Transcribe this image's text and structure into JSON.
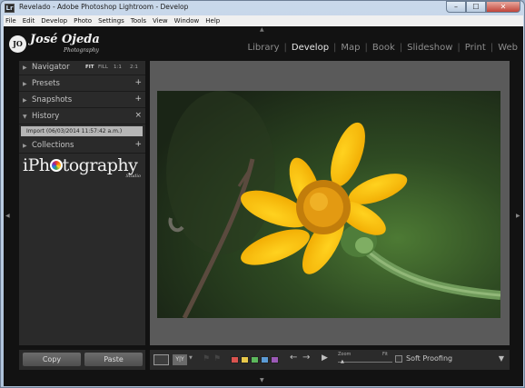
{
  "window": {
    "app_icon": "Lr",
    "title": "Revelado - Adobe Photoshop Lightroom - Develop",
    "minimize": "–",
    "maximize": "☐",
    "close": "✕"
  },
  "menubar": [
    "File",
    "Edit",
    "Develop",
    "Photo",
    "Settings",
    "Tools",
    "View",
    "Window",
    "Help"
  ],
  "identity_plate": {
    "monogram": "JO",
    "name": "José Ojeda",
    "subtitle": "Photography"
  },
  "modules": [
    "Library",
    "Develop",
    "Map",
    "Book",
    "Slideshow",
    "Print",
    "Web"
  ],
  "active_module": "Develop",
  "left_panel": {
    "navigator": {
      "label": "Navigator",
      "zoom": [
        "FIT",
        "FILL",
        "1:1",
        "2:1"
      ]
    },
    "presets": {
      "label": "Presets",
      "action": "+"
    },
    "snapshots": {
      "label": "Snapshots",
      "action": "+"
    },
    "history": {
      "label": "History",
      "action": "×",
      "entry": "Import (06/03/2014 11:57:42 a.m.)"
    },
    "collections": {
      "label": "Collections",
      "action": "+"
    },
    "studio_logo": {
      "text_before": "iPh",
      "text_after": "tography",
      "tagline": "Studio"
    }
  },
  "left_buttons": {
    "copy": "Copy",
    "paste": "Paste"
  },
  "photo": {
    "subject": "yellow flower"
  },
  "toolbar": {
    "before_after": "Y|Y",
    "zoom_label": "Zoom",
    "fit_label": "Fit",
    "soft_proofing": "Soft Proofing",
    "color_labels": [
      "#d9534f",
      "#e8c84a",
      "#5cb85c",
      "#5b9bd5",
      "#9b59b6"
    ]
  }
}
